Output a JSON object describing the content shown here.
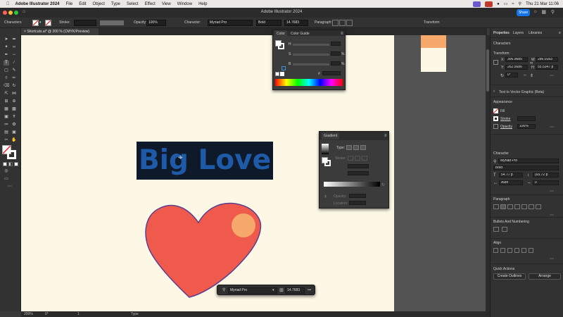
{
  "menubar": {
    "app_name": "Adobe Illustrator 2024",
    "items": [
      "File",
      "Edit",
      "Object",
      "Type",
      "Select",
      "Effect",
      "View",
      "Window",
      "Help"
    ],
    "datetime": "Thu 21 Mar  11:06"
  },
  "window": {
    "title": "Adobe Illustrator 2024",
    "share_label": "Share"
  },
  "control_bar": {
    "selection_type": "Characters",
    "stroke_label": "Stroke:",
    "opacity_label": "Opacity:",
    "opacity_value": "100%",
    "character_label": "Character:",
    "font_family": "Myriad Pro",
    "font_style": "Bold",
    "font_size": "14.7683",
    "paragraph_label": "Paragraph:",
    "transform_label": "Transform"
  },
  "document_tab": {
    "label": "Shortcuts.ai* @ 200 % (CMYK/Preview)"
  },
  "canvas": {
    "text": "Big Love",
    "text_color": "#1f5aa8",
    "text_bg": "#0e1a2a",
    "heart_color": "#f05a4d",
    "heart_stroke": "#5b3f8c",
    "circle_color": "#f7a96b"
  },
  "color_panel": {
    "tabs": [
      "Color",
      "Color Guide"
    ],
    "channels": [
      "H",
      "S",
      "B"
    ],
    "percent": "%",
    "hash": "#"
  },
  "gradient_panel": {
    "title": "Gradient",
    "type_label": "Type:",
    "stroke_label": "Stroke:",
    "opacity_label": "Opacity:",
    "location_label": "Location:"
  },
  "context_bar": {
    "font_family": "Myriad Pro",
    "font_size": "14.7683",
    "more": "•••"
  },
  "status_bar": {
    "zoom": "200%",
    "rotation": "0°",
    "artboard": "1",
    "tool": "Type"
  },
  "right_panel": {
    "tabs": [
      "Properties",
      "Layers",
      "Libraries"
    ],
    "section_characters": "Characters",
    "section_transform": "Transform",
    "x_label": "X:",
    "x_value": "306.9685",
    "y_label": "Y:",
    "y_value": "262.5686",
    "w_label": "W:",
    "w_value": "286.0183",
    "h_label": "H:",
    "h_value": "55.5347 p",
    "rotate_value": "0°",
    "text_to_vector": "Text to Vector Graphic (Beta)",
    "section_appearance": "Appearance",
    "fill_label": "Fill",
    "stroke_label": "Stroke",
    "opacity_label": "Opacity",
    "opacity_value": "100%",
    "section_character": "Character",
    "font_family": "Myriad Pro",
    "font_style": "Bold",
    "font_size": "54.77 p",
    "leading": "(65.72 p",
    "kerning": "Auto",
    "tracking": "0",
    "section_paragraph": "Paragraph",
    "section_bullets": "Bullets And Numbering",
    "section_align": "Align",
    "section_quick_actions": "Quick Actions",
    "create_outlines": "Create Outlines",
    "arrange": "Arrange"
  }
}
